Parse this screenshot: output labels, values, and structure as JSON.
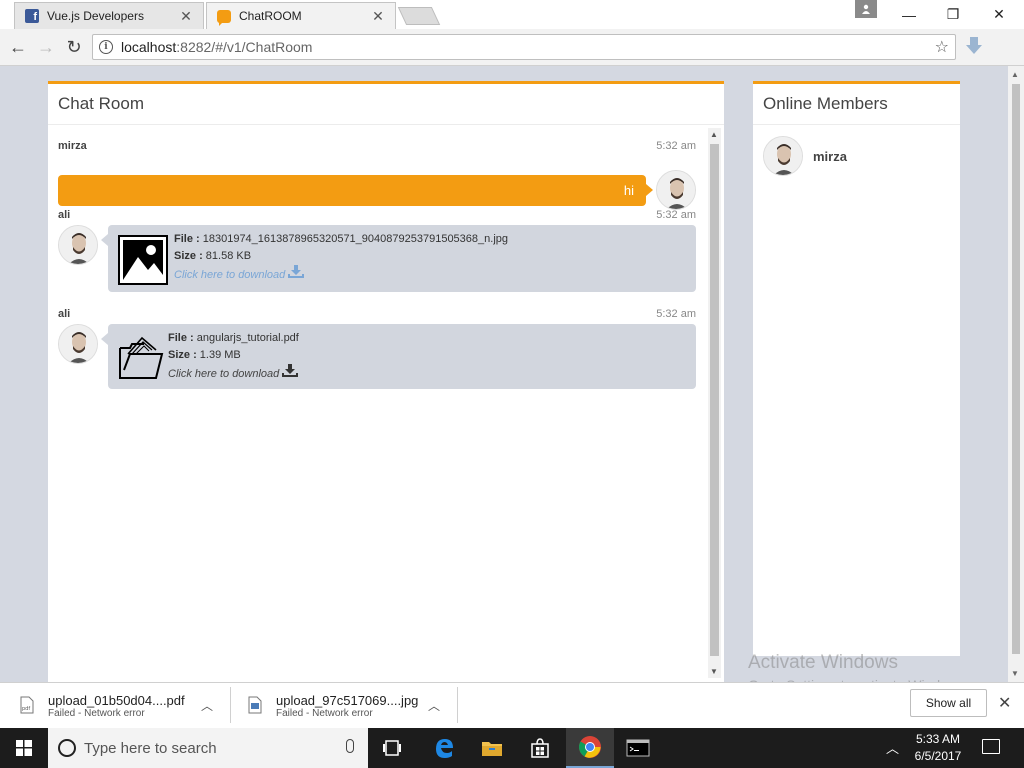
{
  "browser": {
    "tabs": [
      {
        "title": "Vue.js Developers",
        "favicon": "facebook-icon"
      },
      {
        "title": "ChatROOM",
        "favicon": "chat-icon"
      }
    ],
    "url_host": "localhost",
    "url_path": ":8282/#/v1/ChatRoom"
  },
  "chat": {
    "title": "Chat Room",
    "messages": [
      {
        "user": "mirza",
        "time": "5:32 am",
        "text": "hi"
      },
      {
        "user": "ali",
        "time": "5:32 am",
        "file_label": "File :",
        "file_name": "18301974_1613878965320571_9040879253791505368_n.jpg",
        "size_label": "Size :",
        "size": "81.58 KB",
        "download": "Click here to download"
      },
      {
        "user": "ali",
        "time": "5:32 am",
        "file_label": "File :",
        "file_name": "angularjs_tutorial.pdf",
        "size_label": "Size :",
        "size": "1.39 MB",
        "download": "Click here to download"
      }
    ]
  },
  "members": {
    "title": "Online Members",
    "list": [
      {
        "name": "mirza"
      }
    ]
  },
  "watermark": {
    "line1": "Activate Windows",
    "line2": "Go to Settings to activate Windows."
  },
  "downloads": {
    "items": [
      {
        "name": "upload_01b50d04....pdf",
        "status": "Failed - Network error",
        "type": "pdf"
      },
      {
        "name": "upload_97c517069....jpg",
        "status": "Failed - Network error",
        "type": "jpg"
      }
    ],
    "show_all": "Show all"
  },
  "taskbar": {
    "search_placeholder": "Type here to search",
    "time": "5:33 AM",
    "date": "6/5/2017"
  },
  "colors": {
    "accent": "#f39c12",
    "bubble_other": "#d2d6de",
    "link_blue": "#7aa6d6"
  }
}
